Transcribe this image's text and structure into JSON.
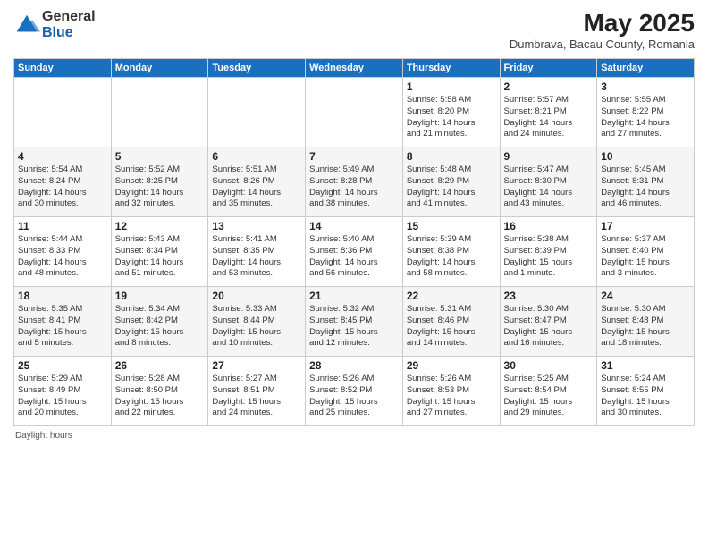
{
  "logo": {
    "general": "General",
    "blue": "Blue"
  },
  "title": "May 2025",
  "subtitle": "Dumbrava, Bacau County, Romania",
  "days_of_week": [
    "Sunday",
    "Monday",
    "Tuesday",
    "Wednesday",
    "Thursday",
    "Friday",
    "Saturday"
  ],
  "weeks": [
    [
      {
        "day": "",
        "info": ""
      },
      {
        "day": "",
        "info": ""
      },
      {
        "day": "",
        "info": ""
      },
      {
        "day": "",
        "info": ""
      },
      {
        "day": "1",
        "info": "Sunrise: 5:58 AM\nSunset: 8:20 PM\nDaylight: 14 hours\nand 21 minutes."
      },
      {
        "day": "2",
        "info": "Sunrise: 5:57 AM\nSunset: 8:21 PM\nDaylight: 14 hours\nand 24 minutes."
      },
      {
        "day": "3",
        "info": "Sunrise: 5:55 AM\nSunset: 8:22 PM\nDaylight: 14 hours\nand 27 minutes."
      }
    ],
    [
      {
        "day": "4",
        "info": "Sunrise: 5:54 AM\nSunset: 8:24 PM\nDaylight: 14 hours\nand 30 minutes."
      },
      {
        "day": "5",
        "info": "Sunrise: 5:52 AM\nSunset: 8:25 PM\nDaylight: 14 hours\nand 32 minutes."
      },
      {
        "day": "6",
        "info": "Sunrise: 5:51 AM\nSunset: 8:26 PM\nDaylight: 14 hours\nand 35 minutes."
      },
      {
        "day": "7",
        "info": "Sunrise: 5:49 AM\nSunset: 8:28 PM\nDaylight: 14 hours\nand 38 minutes."
      },
      {
        "day": "8",
        "info": "Sunrise: 5:48 AM\nSunset: 8:29 PM\nDaylight: 14 hours\nand 41 minutes."
      },
      {
        "day": "9",
        "info": "Sunrise: 5:47 AM\nSunset: 8:30 PM\nDaylight: 14 hours\nand 43 minutes."
      },
      {
        "day": "10",
        "info": "Sunrise: 5:45 AM\nSunset: 8:31 PM\nDaylight: 14 hours\nand 46 minutes."
      }
    ],
    [
      {
        "day": "11",
        "info": "Sunrise: 5:44 AM\nSunset: 8:33 PM\nDaylight: 14 hours\nand 48 minutes."
      },
      {
        "day": "12",
        "info": "Sunrise: 5:43 AM\nSunset: 8:34 PM\nDaylight: 14 hours\nand 51 minutes."
      },
      {
        "day": "13",
        "info": "Sunrise: 5:41 AM\nSunset: 8:35 PM\nDaylight: 14 hours\nand 53 minutes."
      },
      {
        "day": "14",
        "info": "Sunrise: 5:40 AM\nSunset: 8:36 PM\nDaylight: 14 hours\nand 56 minutes."
      },
      {
        "day": "15",
        "info": "Sunrise: 5:39 AM\nSunset: 8:38 PM\nDaylight: 14 hours\nand 58 minutes."
      },
      {
        "day": "16",
        "info": "Sunrise: 5:38 AM\nSunset: 8:39 PM\nDaylight: 15 hours\nand 1 minute."
      },
      {
        "day": "17",
        "info": "Sunrise: 5:37 AM\nSunset: 8:40 PM\nDaylight: 15 hours\nand 3 minutes."
      }
    ],
    [
      {
        "day": "18",
        "info": "Sunrise: 5:35 AM\nSunset: 8:41 PM\nDaylight: 15 hours\nand 5 minutes."
      },
      {
        "day": "19",
        "info": "Sunrise: 5:34 AM\nSunset: 8:42 PM\nDaylight: 15 hours\nand 8 minutes."
      },
      {
        "day": "20",
        "info": "Sunrise: 5:33 AM\nSunset: 8:44 PM\nDaylight: 15 hours\nand 10 minutes."
      },
      {
        "day": "21",
        "info": "Sunrise: 5:32 AM\nSunset: 8:45 PM\nDaylight: 15 hours\nand 12 minutes."
      },
      {
        "day": "22",
        "info": "Sunrise: 5:31 AM\nSunset: 8:46 PM\nDaylight: 15 hours\nand 14 minutes."
      },
      {
        "day": "23",
        "info": "Sunrise: 5:30 AM\nSunset: 8:47 PM\nDaylight: 15 hours\nand 16 minutes."
      },
      {
        "day": "24",
        "info": "Sunrise: 5:30 AM\nSunset: 8:48 PM\nDaylight: 15 hours\nand 18 minutes."
      }
    ],
    [
      {
        "day": "25",
        "info": "Sunrise: 5:29 AM\nSunset: 8:49 PM\nDaylight: 15 hours\nand 20 minutes."
      },
      {
        "day": "26",
        "info": "Sunrise: 5:28 AM\nSunset: 8:50 PM\nDaylight: 15 hours\nand 22 minutes."
      },
      {
        "day": "27",
        "info": "Sunrise: 5:27 AM\nSunset: 8:51 PM\nDaylight: 15 hours\nand 24 minutes."
      },
      {
        "day": "28",
        "info": "Sunrise: 5:26 AM\nSunset: 8:52 PM\nDaylight: 15 hours\nand 25 minutes."
      },
      {
        "day": "29",
        "info": "Sunrise: 5:26 AM\nSunset: 8:53 PM\nDaylight: 15 hours\nand 27 minutes."
      },
      {
        "day": "30",
        "info": "Sunrise: 5:25 AM\nSunset: 8:54 PM\nDaylight: 15 hours\nand 29 minutes."
      },
      {
        "day": "31",
        "info": "Sunrise: 5:24 AM\nSunset: 8:55 PM\nDaylight: 15 hours\nand 30 minutes."
      }
    ]
  ],
  "footer": "Daylight hours"
}
